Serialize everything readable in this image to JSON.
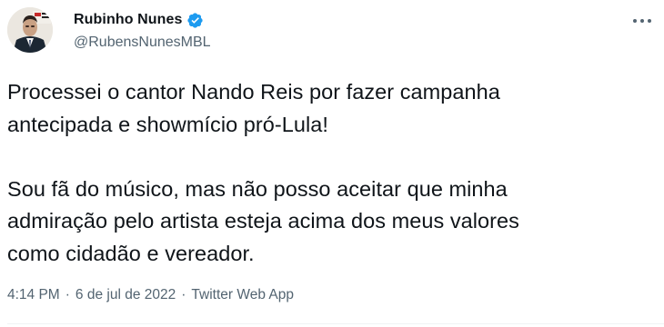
{
  "author": {
    "display_name": "Rubinho Nunes",
    "handle": "@RubensNunesMBL",
    "verified": true
  },
  "icons": {
    "verified": "verified-badge-icon",
    "more": "more-options-icon"
  },
  "colors": {
    "verified_blue": "#1d9bf0",
    "text_primary": "#0f1419",
    "text_secondary": "#536471"
  },
  "tweet": {
    "paragraph_1": "Processei o cantor Nando Reis por fazer campanha\nantecipada e showmício pró-Lula!",
    "paragraph_2": "Sou fã do músico, mas não posso aceitar que minha\nadmiração pelo artista esteja acima dos meus valores\ncomo cidadão e vereador."
  },
  "meta": {
    "time": "4:14 PM",
    "separator": "·",
    "date": "6 de jul de 2022",
    "source": "Twitter Web App"
  }
}
